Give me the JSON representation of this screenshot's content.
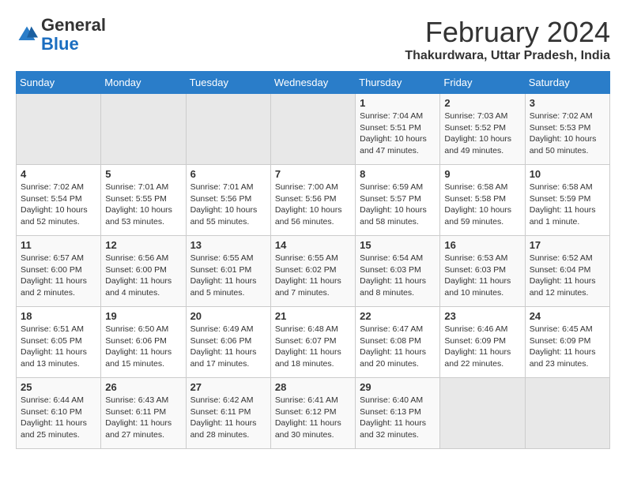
{
  "logo": {
    "general": "General",
    "blue": "Blue"
  },
  "header": {
    "title": "February 2024",
    "subtitle": "Thakurdwara, Uttar Pradesh, India"
  },
  "days_of_week": [
    "Sunday",
    "Monday",
    "Tuesday",
    "Wednesday",
    "Thursday",
    "Friday",
    "Saturday"
  ],
  "weeks": [
    [
      {
        "day": "",
        "empty": true
      },
      {
        "day": "",
        "empty": true
      },
      {
        "day": "",
        "empty": true
      },
      {
        "day": "",
        "empty": true
      },
      {
        "day": "1",
        "sunrise": "7:04 AM",
        "sunset": "5:51 PM",
        "daylight": "10 hours and 47 minutes."
      },
      {
        "day": "2",
        "sunrise": "7:03 AM",
        "sunset": "5:52 PM",
        "daylight": "10 hours and 49 minutes."
      },
      {
        "day": "3",
        "sunrise": "7:02 AM",
        "sunset": "5:53 PM",
        "daylight": "10 hours and 50 minutes."
      }
    ],
    [
      {
        "day": "4",
        "sunrise": "7:02 AM",
        "sunset": "5:54 PM",
        "daylight": "10 hours and 52 minutes."
      },
      {
        "day": "5",
        "sunrise": "7:01 AM",
        "sunset": "5:55 PM",
        "daylight": "10 hours and 53 minutes."
      },
      {
        "day": "6",
        "sunrise": "7:01 AM",
        "sunset": "5:56 PM",
        "daylight": "10 hours and 55 minutes."
      },
      {
        "day": "7",
        "sunrise": "7:00 AM",
        "sunset": "5:56 PM",
        "daylight": "10 hours and 56 minutes."
      },
      {
        "day": "8",
        "sunrise": "6:59 AM",
        "sunset": "5:57 PM",
        "daylight": "10 hours and 58 minutes."
      },
      {
        "day": "9",
        "sunrise": "6:58 AM",
        "sunset": "5:58 PM",
        "daylight": "10 hours and 59 minutes."
      },
      {
        "day": "10",
        "sunrise": "6:58 AM",
        "sunset": "5:59 PM",
        "daylight": "11 hours and 1 minute."
      }
    ],
    [
      {
        "day": "11",
        "sunrise": "6:57 AM",
        "sunset": "6:00 PM",
        "daylight": "11 hours and 2 minutes."
      },
      {
        "day": "12",
        "sunrise": "6:56 AM",
        "sunset": "6:00 PM",
        "daylight": "11 hours and 4 minutes."
      },
      {
        "day": "13",
        "sunrise": "6:55 AM",
        "sunset": "6:01 PM",
        "daylight": "11 hours and 5 minutes."
      },
      {
        "day": "14",
        "sunrise": "6:55 AM",
        "sunset": "6:02 PM",
        "daylight": "11 hours and 7 minutes."
      },
      {
        "day": "15",
        "sunrise": "6:54 AM",
        "sunset": "6:03 PM",
        "daylight": "11 hours and 8 minutes."
      },
      {
        "day": "16",
        "sunrise": "6:53 AM",
        "sunset": "6:03 PM",
        "daylight": "11 hours and 10 minutes."
      },
      {
        "day": "17",
        "sunrise": "6:52 AM",
        "sunset": "6:04 PM",
        "daylight": "11 hours and 12 minutes."
      }
    ],
    [
      {
        "day": "18",
        "sunrise": "6:51 AM",
        "sunset": "6:05 PM",
        "daylight": "11 hours and 13 minutes."
      },
      {
        "day": "19",
        "sunrise": "6:50 AM",
        "sunset": "6:06 PM",
        "daylight": "11 hours and 15 minutes."
      },
      {
        "day": "20",
        "sunrise": "6:49 AM",
        "sunset": "6:06 PM",
        "daylight": "11 hours and 17 minutes."
      },
      {
        "day": "21",
        "sunrise": "6:48 AM",
        "sunset": "6:07 PM",
        "daylight": "11 hours and 18 minutes."
      },
      {
        "day": "22",
        "sunrise": "6:47 AM",
        "sunset": "6:08 PM",
        "daylight": "11 hours and 20 minutes."
      },
      {
        "day": "23",
        "sunrise": "6:46 AM",
        "sunset": "6:09 PM",
        "daylight": "11 hours and 22 minutes."
      },
      {
        "day": "24",
        "sunrise": "6:45 AM",
        "sunset": "6:09 PM",
        "daylight": "11 hours and 23 minutes."
      }
    ],
    [
      {
        "day": "25",
        "sunrise": "6:44 AM",
        "sunset": "6:10 PM",
        "daylight": "11 hours and 25 minutes."
      },
      {
        "day": "26",
        "sunrise": "6:43 AM",
        "sunset": "6:11 PM",
        "daylight": "11 hours and 27 minutes."
      },
      {
        "day": "27",
        "sunrise": "6:42 AM",
        "sunset": "6:11 PM",
        "daylight": "11 hours and 28 minutes."
      },
      {
        "day": "28",
        "sunrise": "6:41 AM",
        "sunset": "6:12 PM",
        "daylight": "11 hours and 30 minutes."
      },
      {
        "day": "29",
        "sunrise": "6:40 AM",
        "sunset": "6:13 PM",
        "daylight": "11 hours and 32 minutes."
      },
      {
        "day": "",
        "empty": true
      },
      {
        "day": "",
        "empty": true
      }
    ]
  ]
}
